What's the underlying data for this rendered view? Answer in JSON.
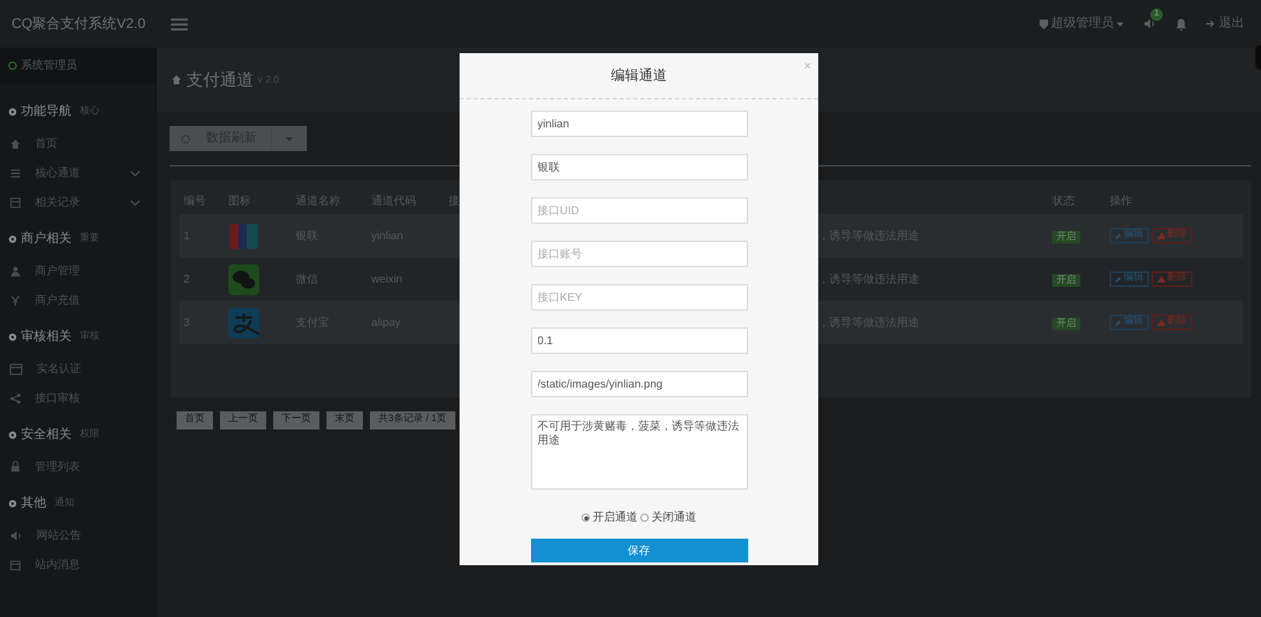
{
  "header": {
    "title": "CQ聚合支付系统V2.0",
    "user": "超级管理员",
    "badge": "1",
    "logout": "退出"
  },
  "sidebar": {
    "status": "系统管理员",
    "sections": [
      {
        "title": "功能导航",
        "tag": "核心",
        "items": [
          {
            "label": "首页",
            "expandable": false
          },
          {
            "label": "核心通道",
            "expandable": true
          },
          {
            "label": "相关记录",
            "expandable": true
          }
        ]
      },
      {
        "title": "商户相关",
        "tag": "重要",
        "items": [
          {
            "label": "商户管理",
            "expandable": false
          },
          {
            "label": "商户充值",
            "expandable": false
          }
        ]
      },
      {
        "title": "审核相关",
        "tag": "审核",
        "items": [
          {
            "label": "实名认证",
            "expandable": false
          },
          {
            "label": "接口审核",
            "expandable": false
          }
        ]
      },
      {
        "title": "安全相关",
        "tag": "权限",
        "items": [
          {
            "label": "管理列表",
            "expandable": false
          }
        ]
      },
      {
        "title": "其他",
        "tag": "通知",
        "items": [
          {
            "label": "网站公告",
            "expandable": false
          },
          {
            "label": "站内消息",
            "expandable": false
          }
        ]
      }
    ]
  },
  "page": {
    "title": "支付通道",
    "version": "v 2.0",
    "refresh_button": "数据刷新"
  },
  "table": {
    "columns": [
      "编号",
      "图标",
      "通道名称",
      "通道代码",
      "接",
      "状态",
      "操作"
    ],
    "rows": [
      {
        "id": "1",
        "kind": "card",
        "name": "银联",
        "code": "yinlian",
        "description": "，诱导等做违法用途",
        "status": "开启",
        "edit": "编辑",
        "delete": "删除"
      },
      {
        "id": "2",
        "kind": "chat",
        "name": "微信",
        "code": "weixin",
        "description": "，诱导等做违法用途",
        "status": "开启",
        "edit": "编辑",
        "delete": "删除"
      },
      {
        "id": "3",
        "kind": "swirl",
        "name": "支付宝",
        "code": "alipay",
        "description": "，诱导等做违法用途",
        "status": "开启",
        "edit": "编辑",
        "delete": "删除"
      }
    ]
  },
  "pagination": [
    "首页",
    "上一页",
    "下一页",
    "末页",
    "共3条记录 / 1页"
  ],
  "dialog": {
    "title": "编辑通道",
    "close": "×",
    "fields": [
      {
        "value": "yinlian"
      },
      {
        "value": "银联"
      },
      {
        "placeholder": "接口UID"
      },
      {
        "placeholder": "接口账号"
      },
      {
        "placeholder": "接口KEY"
      },
      {
        "value": "0.1"
      },
      {
        "value": "/static/images/yinlian.png"
      }
    ],
    "description": "不可用于涉黄赌毒，菠菜，诱导等做违法用途",
    "radios": [
      {
        "label": "开启通道",
        "selected": true
      },
      {
        "label": "关闭通道",
        "selected": false
      }
    ],
    "save": "保存"
  }
}
